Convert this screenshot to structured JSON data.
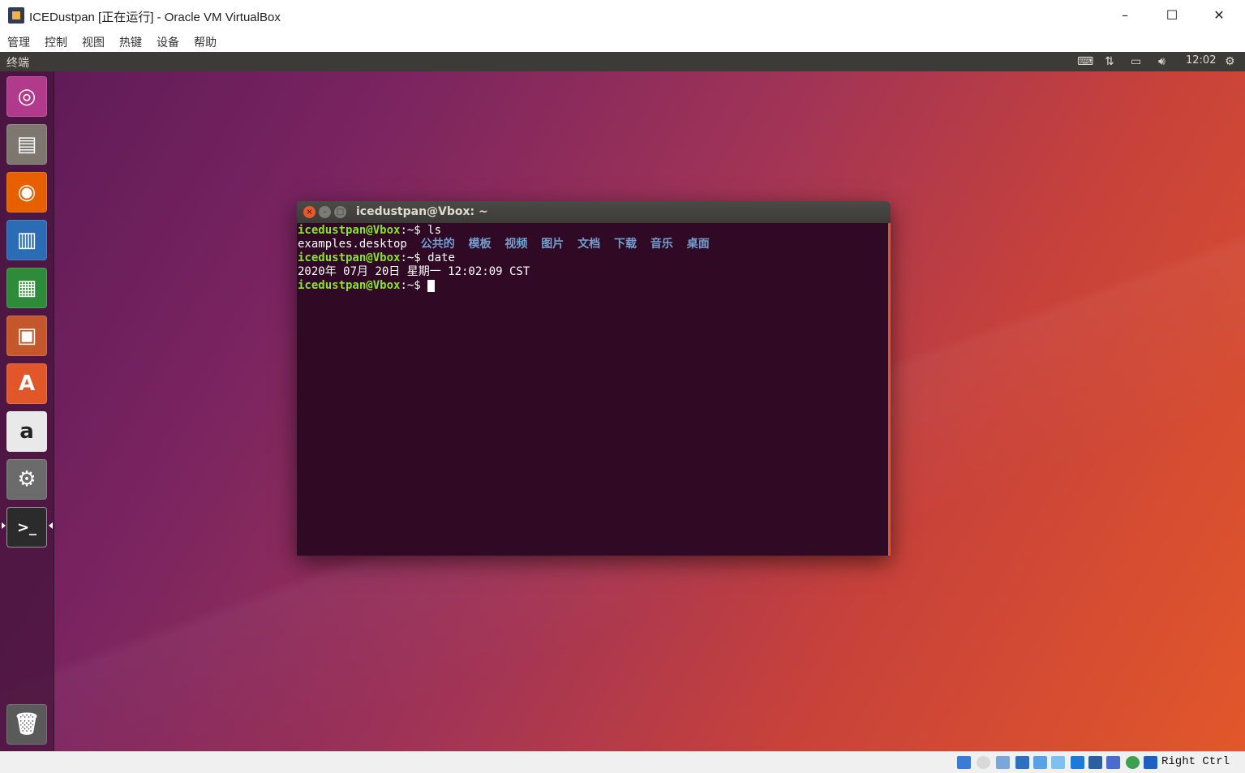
{
  "window": {
    "title": "ICEDustpan [正在运行] - Oracle VM VirtualBox",
    "minimize": "–",
    "maximize": "☐",
    "close": "✕"
  },
  "menu": [
    "管理",
    "控制",
    "视图",
    "热键",
    "设备",
    "帮助"
  ],
  "guest": {
    "panel_title": "终端",
    "clock": "12:02",
    "indicators": [
      "keyboard-icon",
      "network-icon",
      "battery-icon",
      "volume-icon",
      "power-icon"
    ]
  },
  "launcher": [
    {
      "name": "ubuntu-dash-icon",
      "glyph": "◎",
      "bg": "#b23a8c"
    },
    {
      "name": "files-icon",
      "glyph": "▤",
      "bg": "#7d7770"
    },
    {
      "name": "firefox-icon",
      "glyph": "◉",
      "bg": "#e66000"
    },
    {
      "name": "writer-icon",
      "glyph": "▥",
      "bg": "#2a6db5"
    },
    {
      "name": "calc-icon",
      "glyph": "▦",
      "bg": "#2e8b3a"
    },
    {
      "name": "impress-icon",
      "glyph": "▣",
      "bg": "#c4582c"
    },
    {
      "name": "software-center-icon",
      "glyph": "A",
      "bg": "#e2572a"
    },
    {
      "name": "amazon-icon",
      "glyph": "a",
      "bg": "#e9e9e9"
    },
    {
      "name": "system-settings-icon",
      "glyph": "⚙",
      "bg": "#6b6b6b"
    },
    {
      "name": "terminal-icon",
      "glyph": ">_",
      "bg": "#2b2b2b"
    }
  ],
  "terminal": {
    "title": "icedustpan@Vbox: ~",
    "prompt": "icedustpan@Vbox",
    "lines": [
      {
        "prompt": "icedustpan@Vbox",
        "suffix": ":~$ ",
        "cmd": "ls"
      },
      {
        "text": "examples.desktop  ",
        "dirs": "公共的  模板  视频  图片  文档  下载  音乐  桌面"
      },
      {
        "prompt": "icedustpan@Vbox",
        "suffix": ":~$ ",
        "cmd": "date"
      },
      {
        "text": "2020年 07月 20日 星期一 12:02:09 CST"
      },
      {
        "prompt": "icedustpan@Vbox",
        "suffix": ":~$ ",
        "cmd": ""
      }
    ]
  },
  "statusbar": {
    "host_key": "Right Ctrl"
  }
}
